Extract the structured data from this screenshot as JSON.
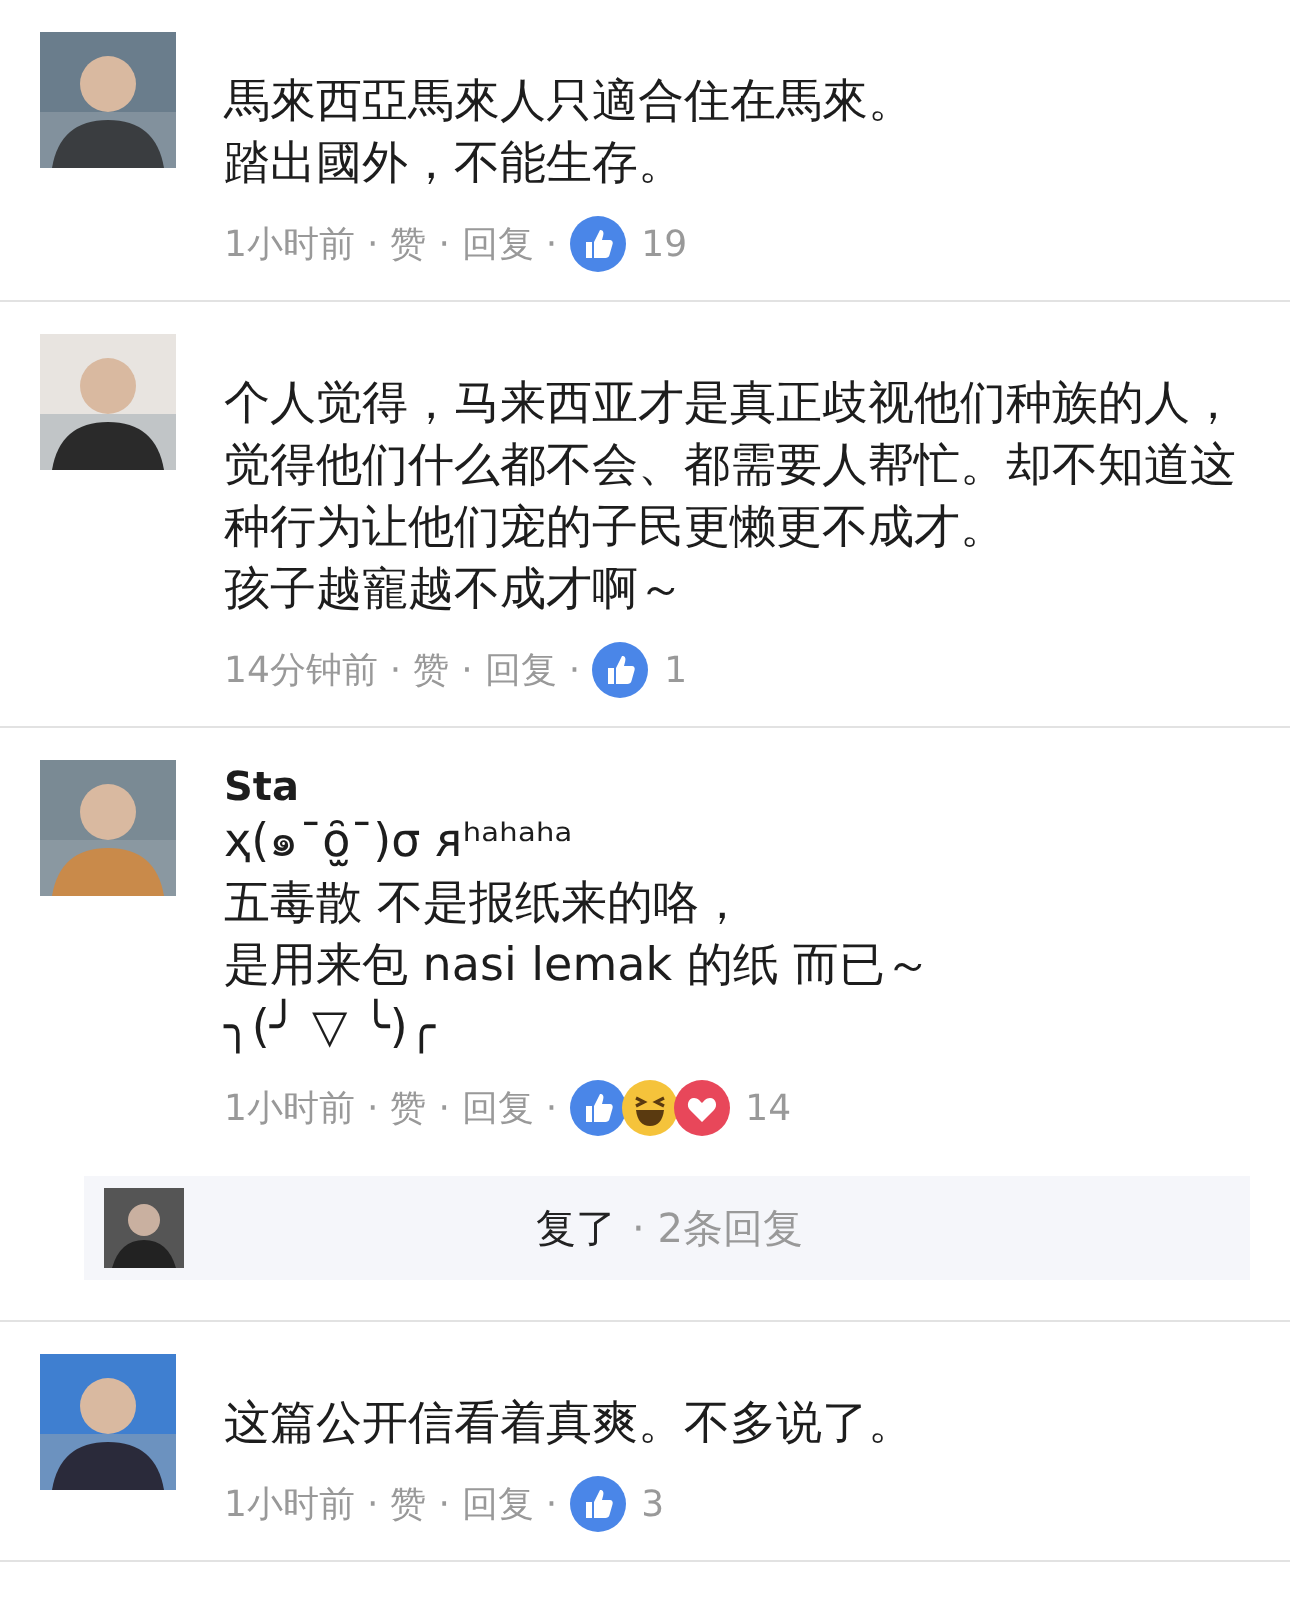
{
  "comments": [
    {
      "lines": [
        "馬來西亞馬來人只適合住在馬來。",
        "踏出國外，不能生存。"
      ],
      "time": "1小时前",
      "sep": "·",
      "like": "赞",
      "reply": "回复",
      "reactions": [
        {
          "kind": "like"
        }
      ],
      "count": "19"
    },
    {
      "lines": [
        "个人觉得，马来西亚才是真正歧视他们种族的人，觉得他们什么都不会、都需要人帮忙。却不知道这种行为让他们宠的子民更懒更不成才。",
        "孩子越寵越不成才啊～"
      ],
      "time": "14分钟前",
      "sep": "·",
      "like": "赞",
      "reply": "回复",
      "reactions": [
        {
          "kind": "like"
        }
      ],
      "count": "1"
    },
    {
      "name": "Sta",
      "lines": [
        "ҳ(๑¯ȏ̫¯)σ ᴙʰᵃʰᵃʰᵃ",
        "五毒散 不是报纸来的咯，",
        "是用来包 nasi lemak 的纸 而已～",
        "╮(╯ ▽ ╰)╭"
      ],
      "time": "1小时前",
      "sep": "·",
      "like": "赞",
      "reply": "回复",
      "reactions": [
        {
          "kind": "like"
        },
        {
          "kind": "haha"
        },
        {
          "kind": "love"
        }
      ],
      "count": "14",
      "replies": {
        "text": "复了",
        "count": "· 2条回复"
      }
    },
    {
      "lines": [
        "这篇公开信看着真爽。不多说了。"
      ],
      "time": "1小时前",
      "sep": "·",
      "like": "赞",
      "reply": "回复",
      "reactions": [
        {
          "kind": "like"
        }
      ],
      "count": "3"
    }
  ]
}
